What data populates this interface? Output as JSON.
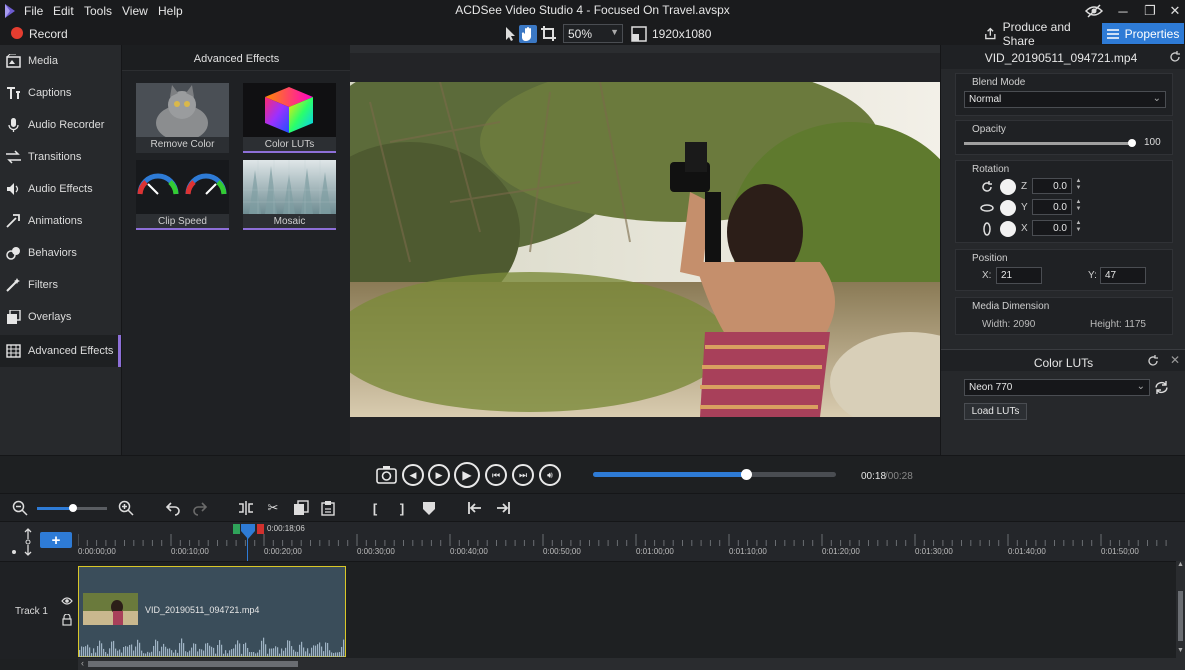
{
  "titlebar": {
    "menus": [
      "File",
      "Edit",
      "Tools",
      "View",
      "Help"
    ],
    "window_title": "ACDSee Video Studio 4 - Focused On Travel.avspx"
  },
  "toolbar": {
    "record_label": "Record",
    "zoom_value": "50%",
    "resolution": "1920x1080",
    "produce_label": "Produce and Share",
    "properties_label": "Properties",
    "accent_color": "#2e7bd6",
    "record_color": "#e43d30"
  },
  "sidebar": {
    "items": [
      {
        "label": "Media",
        "icon": "media-icon"
      },
      {
        "label": "Captions",
        "icon": "captions-icon"
      },
      {
        "label": "Audio Recorder",
        "icon": "microphone-icon"
      },
      {
        "label": "Transitions",
        "icon": "transitions-icon"
      },
      {
        "label": "Audio Effects",
        "icon": "speaker-icon"
      },
      {
        "label": "Animations",
        "icon": "animations-icon"
      },
      {
        "label": "Behaviors",
        "icon": "behaviors-icon"
      },
      {
        "label": "Filters",
        "icon": "filters-icon"
      },
      {
        "label": "Overlays",
        "icon": "overlays-icon"
      },
      {
        "label": "Advanced Effects",
        "icon": "advanced-effects-icon",
        "active": true
      }
    ],
    "active_color": "#8d6fd8"
  },
  "effects": {
    "title": "Advanced Effects",
    "items": [
      {
        "label": "Remove Color"
      },
      {
        "label": "Color LUTs",
        "selected": true
      },
      {
        "label": "Clip Speed",
        "selected": true
      },
      {
        "label": "Mosaic",
        "selected": true
      }
    ]
  },
  "properties": {
    "filename": "VID_20190511_094721.mp4",
    "blend_mode_label": "Blend Mode",
    "blend_mode": "Normal",
    "opacity_label": "Opacity",
    "opacity": "100",
    "rotation_label": "Rotation",
    "rotation": [
      {
        "axis": "Z",
        "value": "0.0"
      },
      {
        "axis": "Y",
        "value": "0.0"
      },
      {
        "axis": "X",
        "value": "0.0"
      }
    ],
    "position_label": "Position",
    "pos_x_label": "X:",
    "pos_x": "21",
    "pos_y_label": "Y:",
    "pos_y": "47",
    "media_dimension_label": "Media Dimension",
    "width_text": "Width: 2090",
    "height_text": "Height: 1175"
  },
  "color_luts": {
    "title": "Color LUTs",
    "lut_value": "Neon 770",
    "load_label": "Load LUTs"
  },
  "transport": {
    "time_current": "00:18",
    "time_total": "/00:28",
    "progress": 0.63
  },
  "timeline": {
    "zoom_level": 0.5,
    "playhead_time": "0:00:18;06",
    "tick_labels": [
      "0:00:00;00",
      "0:00:10;00",
      "0:00:20;00",
      "0:00:30;00",
      "0:00:40;00",
      "0:00:50;00",
      "0:01:00;00",
      "0:01:10;00",
      "0:01:20;00",
      "0:01:30;00",
      "0:01:40;00",
      "0:01:50;00"
    ],
    "track_name": "Track 1",
    "clip_name": "VID_20190511_094721.mp4",
    "clip_border_color": "#d9c728"
  }
}
